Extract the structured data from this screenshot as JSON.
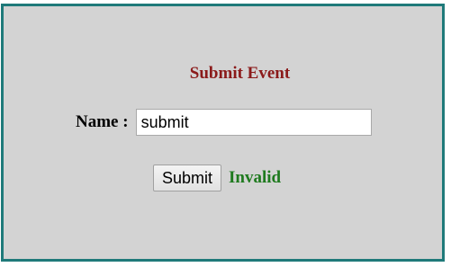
{
  "form": {
    "title": "Submit Event",
    "name_label": "Name :",
    "name_value": "submit",
    "submit_label": "Submit",
    "status_text": "Invalid"
  },
  "colors": {
    "border": "#1f7a7a",
    "panel_bg": "#d3d3d3",
    "title": "#8b1a1a",
    "status": "#1e7a1e"
  }
}
